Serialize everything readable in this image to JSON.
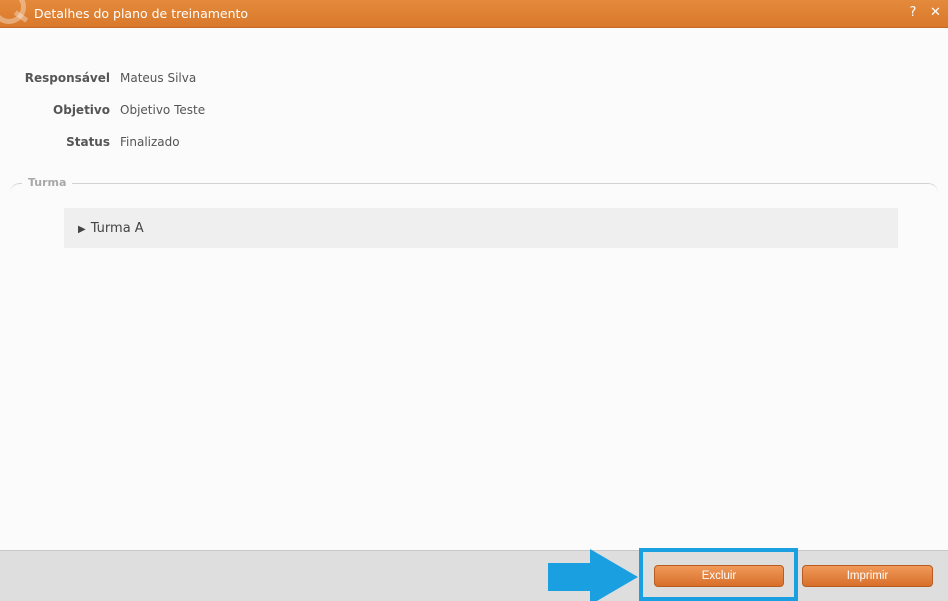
{
  "dialog": {
    "title": "Detalhes do plano de treinamento",
    "help_label": "?",
    "close_label": "✕"
  },
  "details": [
    {
      "label": "Responsável",
      "value": "Mateus Silva"
    },
    {
      "label": "Objetivo",
      "value": "Objetivo Teste"
    },
    {
      "label": "Status",
      "value": "Finalizado"
    }
  ],
  "turma_section": {
    "legend": "Turma",
    "groups": [
      {
        "toggle_symbol": "▶",
        "label": "Turma A"
      }
    ]
  },
  "footer": {
    "delete_label": "Excluir",
    "print_label": "Imprimir"
  },
  "colors": {
    "accent_orange": "#d9782a",
    "highlight_blue": "#1aa0e0"
  }
}
